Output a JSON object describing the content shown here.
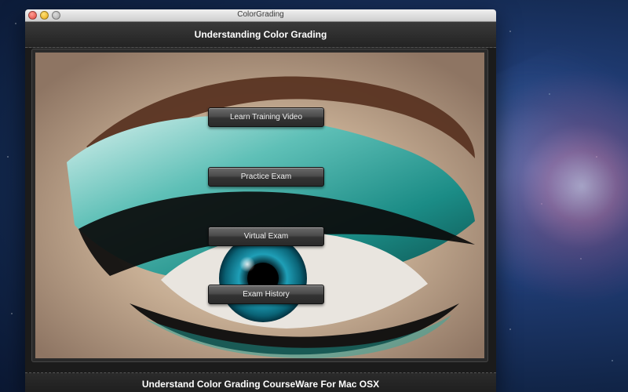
{
  "window": {
    "title": "ColorGrading"
  },
  "header": {
    "title": "Understanding Color Grading"
  },
  "menu": {
    "buttons": [
      {
        "label": "Learn Training Video"
      },
      {
        "label": "Practice Exam"
      },
      {
        "label": "Virtual Exam"
      },
      {
        "label": "Exam History"
      }
    ]
  },
  "footer": {
    "text": "Understand Color Grading CourseWare For Mac OSX"
  },
  "theme": {
    "accent": "#2fb3b0",
    "button_text": "#f0f0f0"
  }
}
